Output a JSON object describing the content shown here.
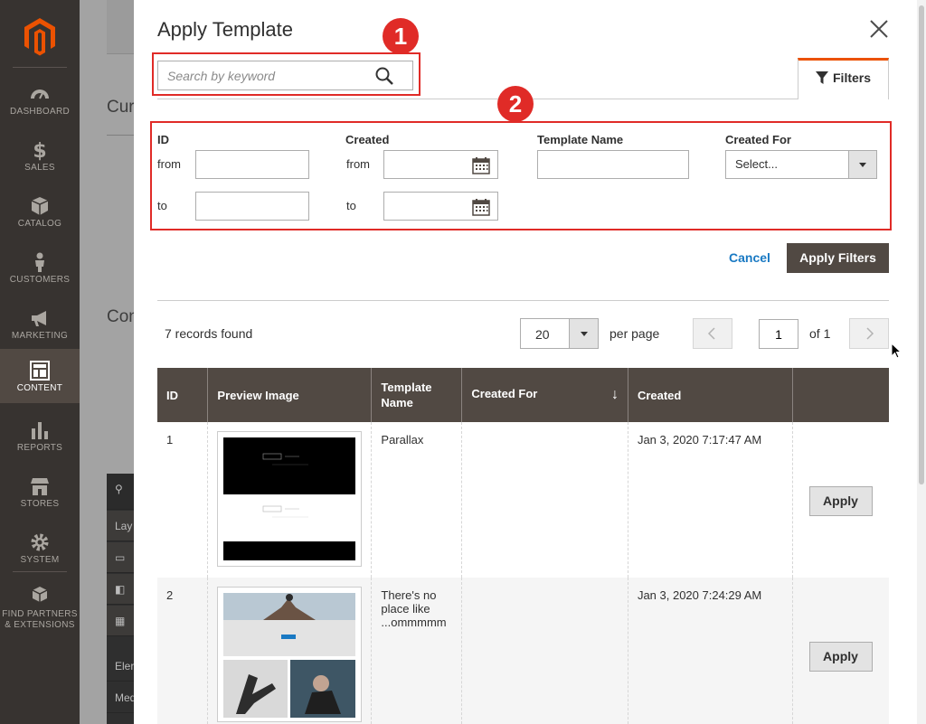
{
  "sidebar": {
    "items": [
      {
        "label": "DASHBOARD",
        "icon": "dashboard-icon"
      },
      {
        "label": "SALES",
        "icon": "dollar-icon"
      },
      {
        "label": "CATALOG",
        "icon": "box-icon"
      },
      {
        "label": "CUSTOMERS",
        "icon": "person-icon"
      },
      {
        "label": "MARKETING",
        "icon": "megaphone-icon"
      },
      {
        "label": "CONTENT",
        "icon": "layout-icon",
        "active": true
      },
      {
        "label": "REPORTS",
        "icon": "bar-chart-icon"
      },
      {
        "label": "STORES",
        "icon": "storefront-icon"
      },
      {
        "label": "SYSTEM",
        "icon": "gear-icon"
      },
      {
        "label": "FIND PARTNERS & EXTENSIONS",
        "icon": "boxes-icon"
      }
    ]
  },
  "background": {
    "frag1": "Cur",
    "frag2": "Con",
    "rows": [
      "Lay",
      "Eler",
      "Med"
    ]
  },
  "modal": {
    "title": "Apply Template",
    "search_placeholder": "Search by keyword",
    "filters_tab": "Filters",
    "markers": [
      "1",
      "2"
    ],
    "filters": {
      "id_label": "ID",
      "created_label": "Created",
      "template_name_label": "Template Name",
      "created_for_label": "Created For",
      "from": "from",
      "to": "to",
      "select_value": "Select..."
    },
    "cancel": "Cancel",
    "apply_filters": "Apply Filters",
    "records_found": "7 records found",
    "per_page_value": "20",
    "per_page_label": "per page",
    "page_value": "1",
    "page_of": "of 1"
  },
  "grid": {
    "headers": [
      "ID",
      "Preview Image",
      "Template Name",
      "Created For",
      "Created",
      ""
    ],
    "sort_indicator": "↓",
    "rows": [
      {
        "id": "1",
        "name": "Parallax",
        "created_for": "",
        "created": "Jan 3, 2020 7:17:47 AM",
        "action": "Apply"
      },
      {
        "id": "2",
        "name": "There's no place like ...ommmmm",
        "created_for": "",
        "created": "Jan 3, 2020 7:24:29 AM",
        "action": "Apply"
      }
    ]
  },
  "colors": {
    "sidebar_bg": "#373330",
    "header_bg": "#514943",
    "marker_red": "#e02b27",
    "accent_orange": "#eb5202",
    "link_blue": "#1979c3"
  }
}
